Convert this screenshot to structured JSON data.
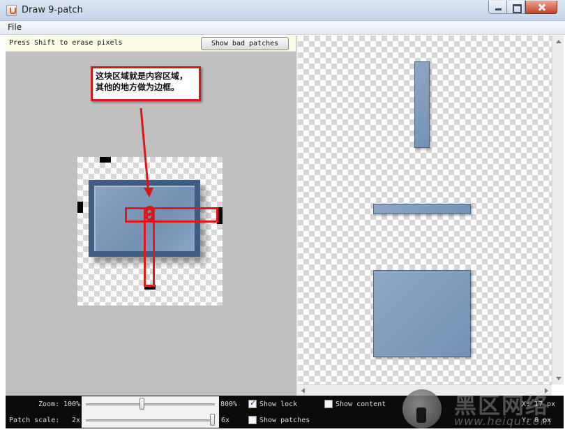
{
  "window": {
    "title": "Draw 9-patch",
    "icon": "java-app-icon"
  },
  "menu": {
    "file_label": "File"
  },
  "editor": {
    "hint_text": "Press Shift to erase pixels",
    "show_bad_patches_label": "Show bad patches"
  },
  "annotation": {
    "line1": "这块区域就是内容区域，",
    "line2": "其他的地方做为边框。",
    "accent_color": "#d81818"
  },
  "status": {
    "zoom_label": "Zoom:",
    "zoom_min": "100%",
    "zoom_max": "800%",
    "zoom_value_fraction": 0.43,
    "patch_scale_label": "Patch scale:",
    "scale_min": "2x",
    "scale_max": "6x",
    "scale_value_fraction": 1.0,
    "show_lock_label": "Show lock",
    "show_lock_checked": true,
    "show_patches_label": "Show patches",
    "show_patches_checked": false,
    "show_content_label": "Show content",
    "show_content_checked": false,
    "x_coord": "X: 17 px",
    "y_coord": "Y:  0 px"
  },
  "watermark": {
    "text": "黑区网络",
    "url": "www.heiqu.com"
  },
  "colors": {
    "patch_fill": "#7491b4",
    "patch_border": "#3f5d82",
    "canvas_bg": "#c0c0c0",
    "status_bg": "#0b0b0b"
  }
}
